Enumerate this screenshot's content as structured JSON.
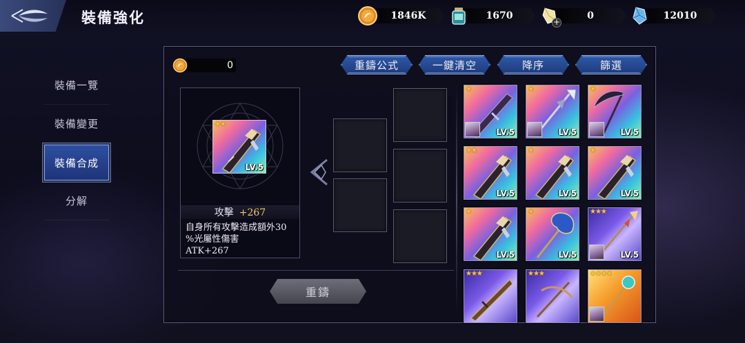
{
  "header": {
    "title": "裝備強化",
    "resources": [
      {
        "name": "gold",
        "value": "1846K",
        "icon": "gold-coin-icon"
      },
      {
        "name": "stamina-drink",
        "value": "1670",
        "icon": "potion-bottle-icon"
      },
      {
        "name": "crystal-shard",
        "value": "0",
        "icon": "crystal-shard-icon"
      },
      {
        "name": "diamond",
        "value": "12010",
        "icon": "blue-crystal-icon"
      }
    ]
  },
  "sidebar": {
    "items": [
      {
        "label": "裝備一覽",
        "active": false
      },
      {
        "label": "裝備變更",
        "active": false
      },
      {
        "label": "裝備合成",
        "active": true
      },
      {
        "label": "分解",
        "active": false
      }
    ]
  },
  "panel": {
    "cost": "0",
    "buttons": {
      "formula": "重鑄公式",
      "clear": "一鍵清空",
      "sort": "降序",
      "filter": "篩選"
    },
    "selected": {
      "level": "LV.5",
      "stars": 2,
      "stat_name": "攻擊",
      "stat_value": "+267",
      "description_1": "自身所有攻擊造成額外30",
      "description_2": "%光屬性傷害",
      "description_3": "ATK+267"
    },
    "recast_label": "重鑄"
  },
  "inventory": [
    {
      "stars": 1,
      "level": "LV.5",
      "weapon": "dark-greatsword",
      "bg": "rainbow",
      "portrait": true
    },
    {
      "stars": 1,
      "level": "LV.5",
      "weapon": "silver-spear",
      "bg": "rainbow",
      "portrait": true
    },
    {
      "stars": 1,
      "level": "LV.5",
      "weapon": "dark-scythe",
      "bg": "rainbow",
      "portrait": true
    },
    {
      "stars": 2,
      "level": "LV.5",
      "weapon": "gold-rifle",
      "bg": "rainbow",
      "portrait": false
    },
    {
      "stars": 1,
      "level": "LV.5",
      "weapon": "gold-rifle",
      "bg": "rainbow",
      "portrait": false
    },
    {
      "stars": 1,
      "level": "LV.5",
      "weapon": "gold-rifle",
      "bg": "rainbow",
      "portrait": false
    },
    {
      "stars": 1,
      "level": "LV.5",
      "weapon": "gold-rifle",
      "bg": "rainbow",
      "portrait": false
    },
    {
      "stars": 1,
      "level": "LV.5",
      "weapon": "blue-staff",
      "bg": "rainbow",
      "portrait": false
    },
    {
      "stars": 3,
      "level": "LV.5",
      "weapon": "gold-spear",
      "bg": "purple",
      "portrait": true
    },
    {
      "stars": 3,
      "level": "",
      "weapon": "bronze-rifle",
      "bg": "purple",
      "portrait": false
    },
    {
      "stars": 3,
      "level": "",
      "weapon": "crossbow",
      "bg": "purple",
      "portrait": false
    },
    {
      "stars": 4,
      "level": "",
      "weapon": "teal-staff",
      "bg": "orange",
      "portrait": true
    }
  ]
}
